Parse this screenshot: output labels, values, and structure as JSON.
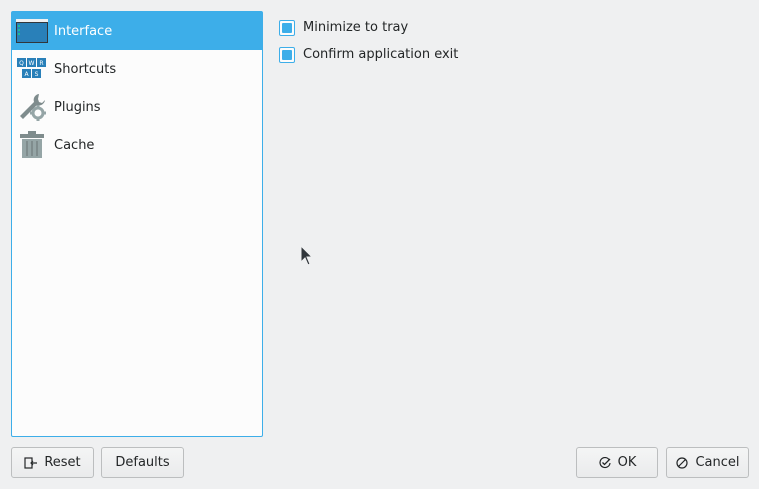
{
  "categories": [
    {
      "label": "Interface",
      "icon": "window-icon",
      "selected": true
    },
    {
      "label": "Shortcuts",
      "icon": "keyboard-icon",
      "selected": false
    },
    {
      "label": "Plugins",
      "icon": "plugins-icon",
      "selected": false
    },
    {
      "label": "Cache",
      "icon": "trash-icon",
      "selected": false
    }
  ],
  "options": [
    {
      "label": "Minimize to tray",
      "checked": true
    },
    {
      "label": "Confirm application exit",
      "checked": true
    }
  ],
  "buttons": {
    "reset_label": "Reset",
    "defaults_label": "Defaults",
    "ok_label": "OK",
    "cancel_label": "Cancel"
  },
  "keyboard_icon_keys": [
    "Q",
    "W",
    "R",
    "A",
    "S"
  ],
  "colors": {
    "accent": "#3daee9",
    "background": "#eff0f1",
    "panel": "#fcfcfc",
    "text": "#232627"
  }
}
